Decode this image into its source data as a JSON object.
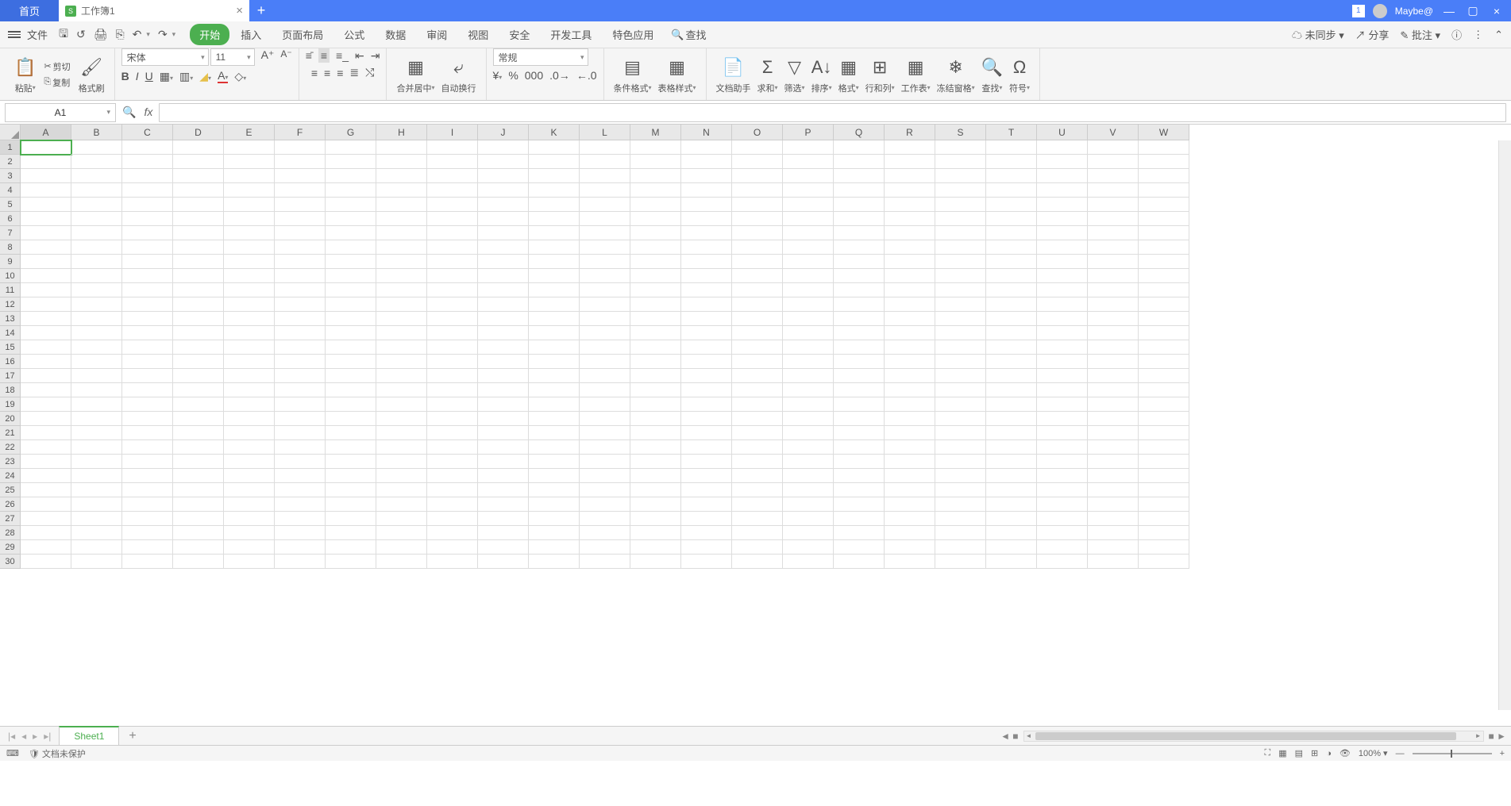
{
  "titlebar": {
    "home_tab": "首页",
    "doc_title": "工作簿1",
    "badge": "1",
    "username": "Maybe@"
  },
  "menubar": {
    "file": "文件",
    "items": [
      "开始",
      "插入",
      "页面布局",
      "公式",
      "数据",
      "审阅",
      "视图",
      "安全",
      "开发工具",
      "特色应用"
    ],
    "active_index": 0,
    "search": "查找",
    "right": {
      "sync": "未同步",
      "share": "分享",
      "approve": "批注"
    }
  },
  "ribbon": {
    "paste": "粘贴",
    "cut": "剪切",
    "copy": "复制",
    "format_painter": "格式刷",
    "font": "宋体",
    "font_size": "11",
    "merge": "合并居中",
    "wrap": "自动换行",
    "number_format": "常规",
    "cond_format": "条件格式",
    "table_style": "表格样式",
    "doc_helper": "文档助手",
    "sum": "求和",
    "filter": "筛选",
    "sort": "排序",
    "format": "格式",
    "rowcol": "行和列",
    "worksheet": "工作表",
    "freeze": "冻结窗格",
    "find": "查找",
    "symbol": "符号"
  },
  "namebar": {
    "cell": "A1"
  },
  "grid": {
    "cols": [
      "A",
      "B",
      "C",
      "D",
      "E",
      "F",
      "G",
      "H",
      "I",
      "J",
      "K",
      "L",
      "M",
      "N",
      "O",
      "P",
      "Q",
      "R",
      "S",
      "T",
      "U",
      "V",
      "W"
    ],
    "rows": [
      1,
      2,
      3,
      4,
      5,
      6,
      7,
      8,
      9,
      10,
      11,
      12,
      13,
      14,
      15,
      16,
      17,
      18,
      19,
      20,
      21,
      22,
      23,
      24,
      25,
      26,
      27,
      28,
      29,
      30
    ],
    "active": "A1"
  },
  "sheetbar": {
    "sheet": "Sheet1"
  },
  "statusbar": {
    "protection": "文档未保护",
    "zoom": "100%"
  }
}
